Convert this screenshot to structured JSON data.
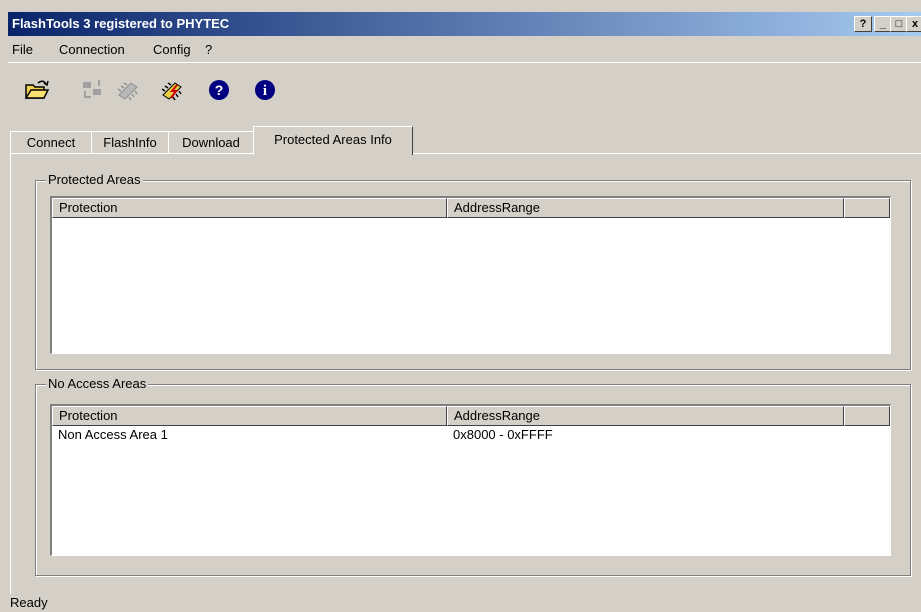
{
  "window": {
    "title": "FlashTools 3  registered to PHYTEC",
    "help_btn": "?",
    "min_btn": "_",
    "max_btn": "□",
    "close_btn": "x"
  },
  "menu": [
    "File",
    "Connection",
    "Config",
    "?"
  ],
  "toolbar": [
    "open-folder-icon",
    "transfer-icon",
    "chip-icon",
    "flash-chip-icon",
    "help-icon",
    "info-icon"
  ],
  "tabs": [
    "Connect",
    "FlashInfo",
    "Download",
    "Protected Areas Info"
  ],
  "active_tab": "Protected Areas Info",
  "protected_areas": {
    "label": "Protected Areas",
    "columns": [
      "Protection",
      "AddressRange",
      ""
    ],
    "rows": []
  },
  "no_access_areas": {
    "label": "No Access Areas",
    "columns": [
      "Protection",
      "AddressRange",
      ""
    ],
    "rows": [
      {
        "protection": "Non Access Area 1",
        "range": "0x8000 - 0xFFFF"
      }
    ]
  },
  "status": "Ready"
}
